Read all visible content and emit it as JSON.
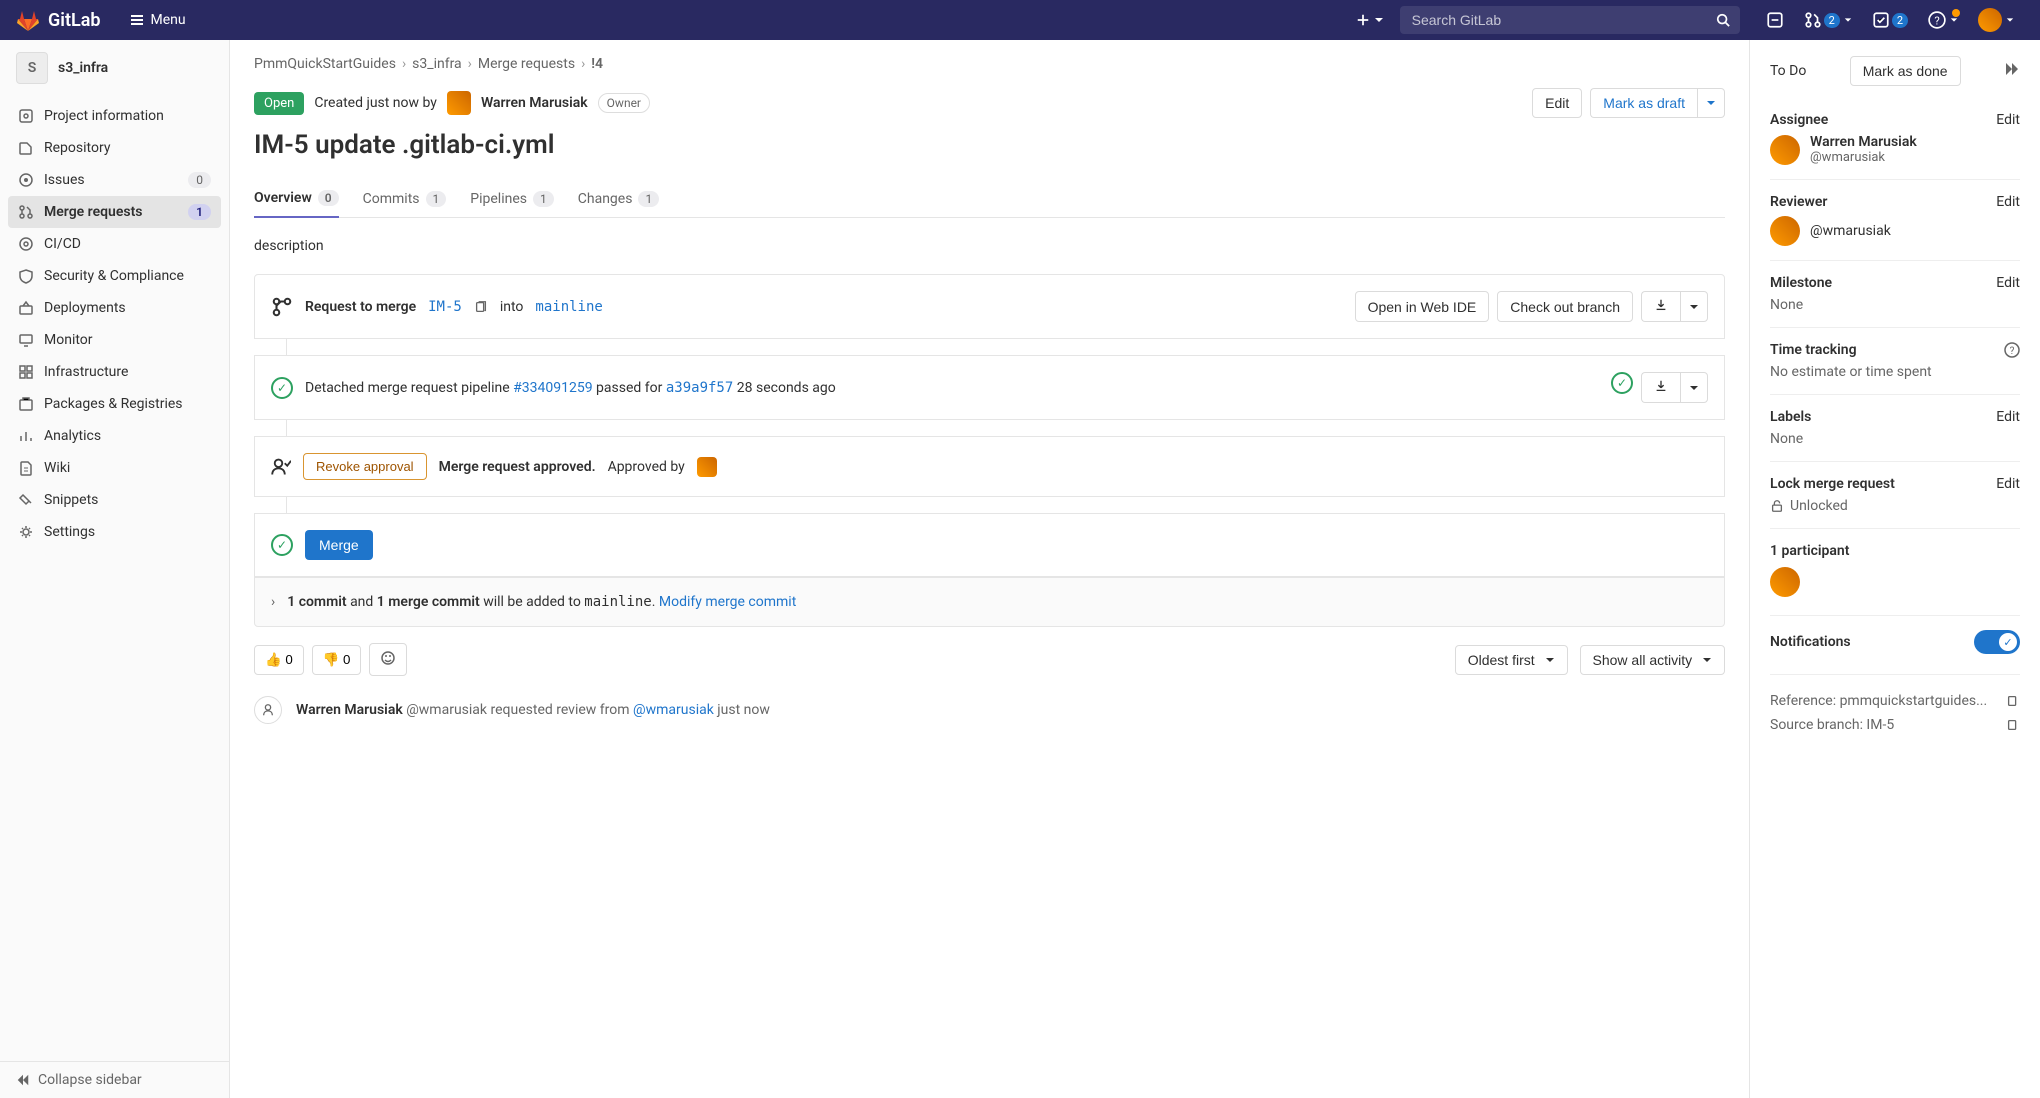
{
  "navbar": {
    "brand": "GitLab",
    "menu": "Menu",
    "search_placeholder": "Search GitLab",
    "mr_count": "2",
    "todo_count": "2"
  },
  "sidebar": {
    "project_initial": "S",
    "project_name": "s3_infra",
    "items": [
      {
        "label": "Project information"
      },
      {
        "label": "Repository"
      },
      {
        "label": "Issues",
        "badge": "0",
        "badge_class": "gray"
      },
      {
        "label": "Merge requests",
        "badge": "1",
        "badge_class": "",
        "active": true
      },
      {
        "label": "CI/CD"
      },
      {
        "label": "Security & Compliance"
      },
      {
        "label": "Deployments"
      },
      {
        "label": "Monitor"
      },
      {
        "label": "Infrastructure"
      },
      {
        "label": "Packages & Registries"
      },
      {
        "label": "Analytics"
      },
      {
        "label": "Wiki"
      },
      {
        "label": "Snippets"
      },
      {
        "label": "Settings"
      }
    ],
    "collapse": "Collapse sidebar"
  },
  "breadcrumb": {
    "a": "PmmQuickStartGuides",
    "b": "s3_infra",
    "c": "Merge requests",
    "d": "!4"
  },
  "mr": {
    "status": "Open",
    "created_text": "Created just now by",
    "author": "Warren Marusiak",
    "owner": "Owner",
    "edit": "Edit",
    "mark_draft": "Mark as draft",
    "title": "IM-5 update .gitlab-ci.yml",
    "tabs": {
      "overview": "Overview",
      "overview_count": "0",
      "commits": "Commits",
      "commits_count": "1",
      "pipelines": "Pipelines",
      "pipelines_count": "1",
      "changes": "Changes",
      "changes_count": "1"
    },
    "description": "description",
    "merge_widget": {
      "request_to_merge": "Request to merge",
      "source_branch": "IM-5",
      "into": "into",
      "target_branch": "mainline",
      "open_ide": "Open in Web IDE",
      "check_out": "Check out branch"
    },
    "pipeline": {
      "prefix": "Detached merge request pipeline",
      "id": "#334091259",
      "mid": "passed for",
      "sha": "a39a9f57",
      "suffix": "28 seconds ago"
    },
    "approval": {
      "revoke": "Revoke approval",
      "approved": "Merge request approved.",
      "approved_by": "Approved by"
    },
    "merge_action": "Merge",
    "commit_info": {
      "bold1": "1 commit",
      "mid1": " and ",
      "bold2": "1 merge commit",
      "mid2": " will be added to ",
      "branch": "mainline",
      "dot": ". ",
      "modify": "Modify merge commit"
    },
    "reactions": {
      "thumbs_up": "0",
      "thumbs_down": "0",
      "sort": "Oldest first",
      "filter": "Show all activity"
    },
    "timeline": {
      "actor": "Warren Marusiak",
      "handle": "@wmarusiak",
      "mid": "requested review from",
      "target": "@wmarusiak",
      "when": "just now"
    }
  },
  "rightbar": {
    "todo": "To Do",
    "mark_done": "Mark as done",
    "assignee": "Assignee",
    "edit": "Edit",
    "assignee_name": "Warren Marusiak",
    "assignee_handle": "@wmarusiak",
    "reviewer": "Reviewer",
    "reviewer_handle": "@wmarusiak",
    "milestone": "Milestone",
    "none": "None",
    "time_tracking": "Time tracking",
    "time_none": "No estimate or time spent",
    "labels": "Labels",
    "lock": "Lock merge request",
    "unlocked": "Unlocked",
    "participants": "1 participant",
    "notifications": "Notifications",
    "reference": "Reference: pmmquickstartguides...",
    "source_branch": "Source branch: IM-5"
  }
}
